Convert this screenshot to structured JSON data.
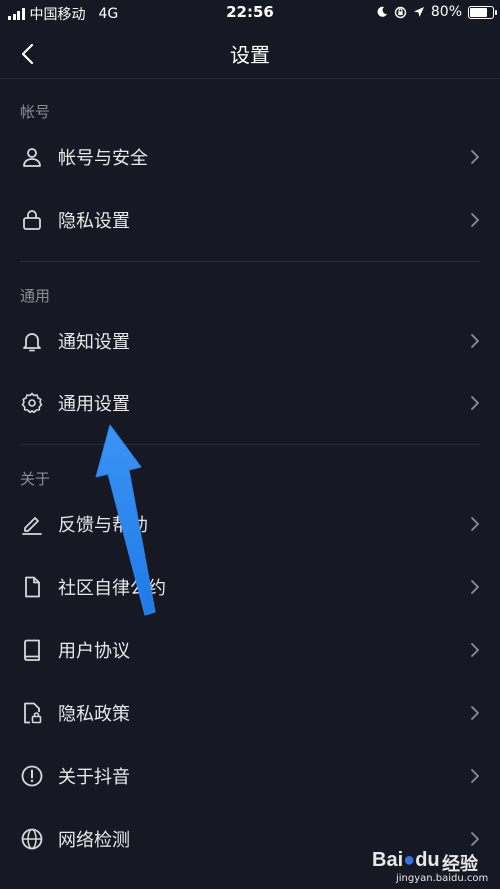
{
  "status_bar": {
    "carrier": "中国移动",
    "network": "4G",
    "time": "22:56",
    "battery": "80%",
    "battery_level": 0.8,
    "icons": [
      "signal-icon",
      "moon-icon",
      "rotation-lock-icon",
      "location-icon",
      "battery-icon"
    ]
  },
  "nav": {
    "title": "设置",
    "back_icon": "chevron-left-icon"
  },
  "sections": [
    {
      "label": "帐号",
      "items": [
        {
          "label": "帐号与安全",
          "icon": "user-icon"
        },
        {
          "label": "隐私设置",
          "icon": "lock-icon"
        }
      ]
    },
    {
      "label": "通用",
      "items": [
        {
          "label": "通知设置",
          "icon": "bell-icon"
        },
        {
          "label": "通用设置",
          "icon": "gear-icon"
        }
      ]
    },
    {
      "label": "关于",
      "items": [
        {
          "label": "反馈与帮助",
          "icon": "edit-icon"
        },
        {
          "label": "社区自律公约",
          "icon": "document-icon"
        },
        {
          "label": "用户协议",
          "icon": "book-icon"
        },
        {
          "label": "隐私政策",
          "icon": "private-document-icon"
        },
        {
          "label": "关于抖音",
          "icon": "info-icon"
        },
        {
          "label": "网络检测",
          "icon": "globe-icon"
        }
      ]
    }
  ],
  "annotation": {
    "arrow_color": "#1e7be6"
  },
  "watermark": {
    "logo": "Bai",
    "logo_suffix": "du",
    "word": "经验",
    "url": "jingyan.baidu.com"
  },
  "colors": {
    "background": "#161823",
    "text": "#e8e8ea",
    "section_label": "#8b8c94",
    "divider": "#2a2c38"
  }
}
